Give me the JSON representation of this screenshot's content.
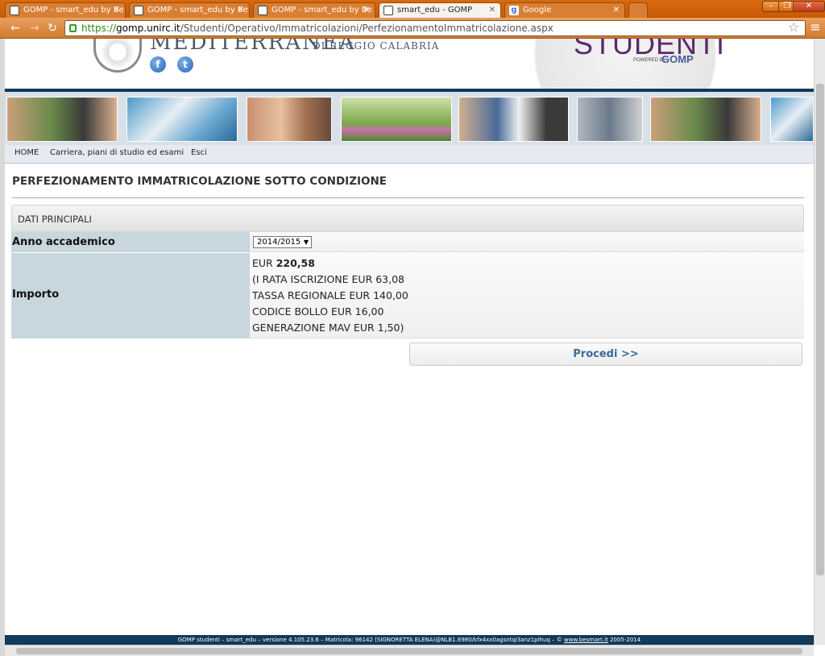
{
  "browser": {
    "tabs": [
      {
        "title": "GOMP - smart_edu by Be",
        "active": false
      },
      {
        "title": "GOMP - smart_edu by Be",
        "active": false
      },
      {
        "title": "GOMP - smart_edu by Be",
        "active": false
      },
      {
        "title": "smart_edu - GOMP",
        "active": true
      },
      {
        "title": "Google",
        "active": false
      }
    ],
    "url_scheme": "https://",
    "url_host": "gomp.unirc.it",
    "url_path": "/Studenti/Operativo/Immatricolazioni/PerfezionamentoImmatricolazione.aspx"
  },
  "header": {
    "university_name": "MEDITERRANEA",
    "university_sub": "DI REGGIO CALABRIA",
    "portal_name": "STUDENTI",
    "powered_by": "POWERED BY",
    "brand": "GOMP"
  },
  "nav": {
    "items": [
      "HOME",
      "Carriera, piani di studio ed esami",
      "Esci"
    ]
  },
  "page": {
    "title": "PERFEZIONAMENTO IMMATRICOLAZIONE SOTTO CONDIZIONE",
    "section_title": "DATI PRINCIPALI",
    "anno_label": "Anno accademico",
    "anno_value": "2014/2015",
    "importo_label": "Importo",
    "importo_lines": {
      "total_prefix": "EUR ",
      "total_amount": "220,58",
      "line1": "(I RATA ISCRIZIONE EUR 63,08",
      "line2": "TASSA REGIONALE EUR 140,00",
      "line3": "CODICE BOLLO EUR 16,00",
      "line4": "GENERAZIONE MAV EUR 1,50)"
    },
    "procedi_label": "Procedi >>"
  },
  "footer": {
    "text": "GOMP studenti – smart_edu – versione 4.105.23.6 – Matricola: 96142 (SIGNORETTA ELENA)@NLB1.6980/kfx4xx0agsntqi3anz1pihuq – © ",
    "link": "www.besmart.it",
    "years": " 2005-2014"
  },
  "colors": {
    "navy": "#123a5a",
    "label_bg": "#c8d6dd",
    "procedi_text": "#3a6a9a",
    "chrome_orange": "#d96a10"
  }
}
